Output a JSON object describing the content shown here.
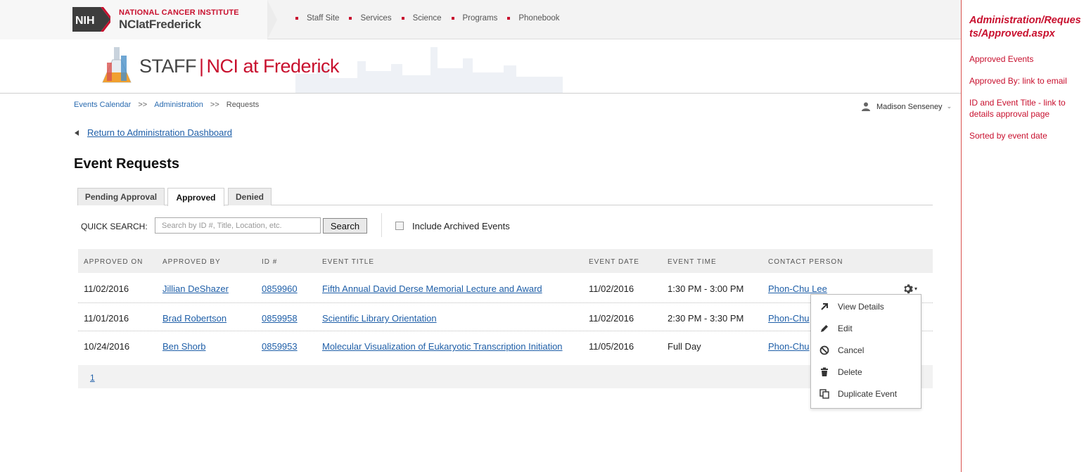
{
  "header": {
    "org_line1": "NATIONAL CANCER INSTITUTE",
    "org_line2": "NCIatFrederick",
    "nih": "NIH",
    "nav": [
      "Staff Site",
      "Services",
      "Science",
      "Programs",
      "Phonebook"
    ]
  },
  "banner": {
    "staff": "STAFF",
    "sep": "|",
    "nci": "NCI at Frederick"
  },
  "breadcrumb": {
    "items": [
      "Events Calendar",
      "Administration",
      "Requests"
    ],
    "separator": ">>"
  },
  "user": {
    "name": "Madison Senseney"
  },
  "back_link": "Return to Administration Dashboard",
  "page_title": "Event Requests",
  "tabs": [
    {
      "label": "Pending Approval",
      "active": false
    },
    {
      "label": "Approved",
      "active": true
    },
    {
      "label": "Denied",
      "active": false
    }
  ],
  "search": {
    "label": "QUICK SEARCH:",
    "placeholder": "Search by ID #, Title, Location, etc.",
    "value": "",
    "button": "Search",
    "archived_label": "Include Archived Events",
    "archived_checked": false
  },
  "table": {
    "columns": [
      "APPROVED ON",
      "APPROVED BY",
      "ID #",
      "EVENT TITLE",
      "EVENT DATE",
      "EVENT TIME",
      "CONTACT PERSON"
    ],
    "rows": [
      {
        "approved_on": "11/02/2016",
        "approved_by": "Jillian DeShazer",
        "id": "0859960",
        "title": "Fifth Annual David Derse Memorial Lecture and Award",
        "date": "11/02/2016",
        "time": "1:30 PM - 3:00 PM",
        "contact": "Phon-Chu Lee"
      },
      {
        "approved_on": "11/01/2016",
        "approved_by": "Brad Robertson",
        "id": "0859958",
        "title": "Scientific Library Orientation",
        "date": "11/02/2016",
        "time": "2:30 PM - 3:30 PM",
        "contact": "Phon-Chu"
      },
      {
        "approved_on": "10/24/2016",
        "approved_by": "Ben Shorb",
        "id": "0859953",
        "title": "Molecular Visualization of Eukaryotic Transcription Initiation",
        "date": "11/05/2016",
        "time": "Full Day",
        "contact": "Phon-Chu"
      }
    ]
  },
  "pager": {
    "current": "1"
  },
  "row_menu": {
    "items": [
      {
        "label": "View Details",
        "icon": "arrow-up-right-icon"
      },
      {
        "label": "Edit",
        "icon": "pencil-icon"
      },
      {
        "label": "Cancel",
        "icon": "ban-icon"
      },
      {
        "label": "Delete",
        "icon": "trash-icon"
      },
      {
        "label": "Duplicate Event",
        "icon": "copy-icon"
      }
    ]
  },
  "notes": {
    "title": "Administration/Requests/Approved.aspx",
    "items": [
      "Approved Events",
      "Approved By: link to email",
      "ID and Event Title - link to details approval page",
      "Sorted by  event date"
    ]
  },
  "colors": {
    "brand_red": "#c8102e",
    "link_blue": "#1f5fa8",
    "note_red": "#c8102e"
  }
}
